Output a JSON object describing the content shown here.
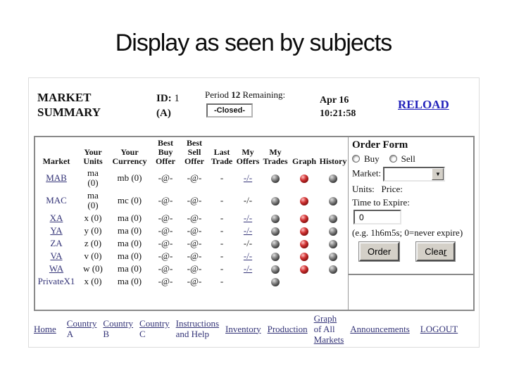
{
  "title": "Display as seen by subjects",
  "header": {
    "market_summary": "MARKET SUMMARY",
    "id_label": "ID:",
    "id_value": "1",
    "id_sub": "(A)",
    "period_label": "Period",
    "period_value": "12",
    "remaining_label": "Remaining:",
    "period_status": "-Closed-",
    "date": "Apr 16",
    "time": "10:21:58",
    "reload_label": "RELOAD"
  },
  "market_table": {
    "columns": [
      [
        "Market"
      ],
      [
        "Your",
        "Units"
      ],
      [
        "Your",
        "Currency"
      ],
      [
        "Best",
        "Buy",
        "Offer"
      ],
      [
        "Best",
        "Sell",
        "Offer"
      ],
      [
        "Last",
        "Trade"
      ],
      [
        "My",
        "Offers"
      ],
      [
        "My",
        "Trades"
      ],
      [
        "Graph"
      ],
      [
        "History"
      ]
    ],
    "rows": [
      {
        "market": "MAB",
        "market_underline": true,
        "units": [
          "ma",
          "(0)"
        ],
        "currency": "mb (0)",
        "best_buy": "-@-",
        "best_sell": "-@-",
        "last_trade": "-",
        "my_offers": "-/-",
        "my_offers_underline": true,
        "trades_ball": "gray",
        "graph_ball": "red",
        "history_ball": "gray"
      },
      {
        "market": "MAC",
        "market_underline": false,
        "units": [
          "ma",
          "(0)"
        ],
        "currency": "mc (0)",
        "best_buy": "-@-",
        "best_sell": "-@-",
        "last_trade": "-",
        "my_offers": "-/-",
        "my_offers_underline": false,
        "trades_ball": "gray",
        "graph_ball": "red",
        "history_ball": "gray"
      },
      {
        "market": "XA",
        "market_underline": true,
        "units": [
          "x (0)"
        ],
        "currency": "ma (0)",
        "best_buy": "-@-",
        "best_sell": "-@-",
        "last_trade": "-",
        "my_offers": "-/-",
        "my_offers_underline": true,
        "trades_ball": "gray",
        "graph_ball": "red",
        "history_ball": "gray"
      },
      {
        "market": "YA",
        "market_underline": true,
        "units": [
          "y (0)"
        ],
        "currency": "ma (0)",
        "best_buy": "-@-",
        "best_sell": "-@-",
        "last_trade": "-",
        "my_offers": "-/-",
        "my_offers_underline": true,
        "trades_ball": "gray",
        "graph_ball": "red",
        "history_ball": "gray"
      },
      {
        "market": "ZA",
        "market_underline": false,
        "units": [
          "z (0)"
        ],
        "currency": "ma (0)",
        "best_buy": "-@-",
        "best_sell": "-@-",
        "last_trade": "-",
        "my_offers": "-/-",
        "my_offers_underline": false,
        "trades_ball": "gray",
        "graph_ball": "red",
        "history_ball": "gray"
      },
      {
        "market": "VA",
        "market_underline": true,
        "units": [
          "v (0)"
        ],
        "currency": "ma (0)",
        "best_buy": "-@-",
        "best_sell": "-@-",
        "last_trade": "-",
        "my_offers": "-/-",
        "my_offers_underline": true,
        "trades_ball": "gray",
        "graph_ball": "red",
        "history_ball": "gray"
      },
      {
        "market": "WA",
        "market_underline": true,
        "units": [
          "w (0)"
        ],
        "currency": "ma (0)",
        "best_buy": "-@-",
        "best_sell": "-@-",
        "last_trade": "-",
        "my_offers": "-/-",
        "my_offers_underline": true,
        "trades_ball": "gray",
        "graph_ball": "red",
        "history_ball": "gray"
      },
      {
        "market": "PrivateX1",
        "market_underline": false,
        "units": [
          "x (0)"
        ],
        "currency": "ma (0)",
        "best_buy": "-@-",
        "best_sell": "-@-",
        "last_trade": "-",
        "my_offers": "",
        "my_offers_underline": false,
        "trades_ball": "gray",
        "graph_ball": null,
        "history_ball": null
      }
    ]
  },
  "order_form": {
    "title": "Order Form",
    "buy_label": "Buy",
    "sell_label": "Sell",
    "market_label": "Market:",
    "units_label": "Units:",
    "price_label": "Price:",
    "expire_label": "Time to Expire:",
    "expire_value": "0",
    "expire_hint": "(e.g. 1h6m5s; 0=never expire)",
    "order_button": "Order",
    "clear_button_prefix": "Clea",
    "clear_button_accesskey": "r",
    "dropdown_arrow_icon": "▼"
  },
  "nav": {
    "items": [
      {
        "name": "home",
        "lines": [
          [
            "Home",
            true
          ]
        ]
      },
      {
        "name": "country-a",
        "lines": [
          [
            "Country",
            true
          ],
          [
            "A",
            false
          ]
        ]
      },
      {
        "name": "country-b",
        "lines": [
          [
            "Country",
            true
          ],
          [
            "B",
            false
          ]
        ]
      },
      {
        "name": "country-c",
        "lines": [
          [
            "Country",
            true
          ],
          [
            "C",
            false
          ]
        ]
      },
      {
        "name": "instructions-and-help",
        "lines": [
          [
            "Instructions",
            true
          ],
          [
            "and Help",
            false
          ]
        ]
      },
      {
        "name": "inventory",
        "lines": [
          [
            "Inventory",
            true
          ]
        ]
      },
      {
        "name": "production",
        "lines": [
          [
            "Production",
            true
          ]
        ]
      },
      {
        "name": "graph-of-all-markets",
        "lines": [
          [
            "Graph",
            true
          ],
          [
            "of All",
            false
          ],
          [
            "Markets",
            true
          ]
        ]
      },
      {
        "name": "announcements",
        "lines": [
          [
            "Announcements",
            true
          ]
        ]
      },
      {
        "name": "logout",
        "lines": [
          [
            "LOGOUT",
            true
          ]
        ]
      }
    ]
  },
  "colors": {
    "link_navy": "#333377",
    "reload_blue": "#2323bb",
    "ball_gray": "#3b3b3b",
    "ball_red": "#b01818"
  }
}
